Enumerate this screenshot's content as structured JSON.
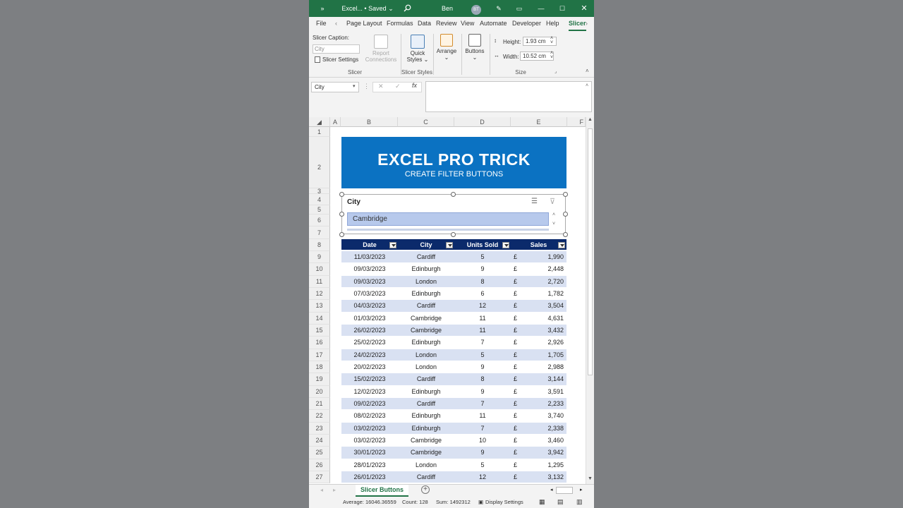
{
  "titlebar": {
    "more_label": "»",
    "file_label": "Excel... • Saved",
    "user_name": "Ben Thompson",
    "user_initials": "BT"
  },
  "ribbon_tabs": [
    "File",
    "Page Layout",
    "Formulas",
    "Data",
    "Review",
    "View",
    "Automate",
    "Developer",
    "Help",
    "Slicer"
  ],
  "ribbon": {
    "slicer_caption_label": "Slicer Caption:",
    "slicer_caption_value": "City",
    "slicer_settings_label": "Slicer Settings",
    "report_connections_label1": "Report",
    "report_connections_label2": "Connections",
    "quick_styles_label1": "Quick",
    "quick_styles_label2": "Styles",
    "arrange_label": "Arrange",
    "buttons_label": "Buttons",
    "height_label": "Height:",
    "height_value": "1.93 cm",
    "width_label": "Width:",
    "width_value": "10.52 cm",
    "group_slicer": "Slicer",
    "group_slicer_styles": "Slicer Styles",
    "group_size": "Size"
  },
  "formula_bar": {
    "name_box": "City",
    "fx_label": "fx",
    "value": ""
  },
  "columns": [
    "A",
    "B",
    "C",
    "D",
    "E",
    "F"
  ],
  "rows": [
    "1",
    "2",
    "3",
    "4",
    "5",
    "6",
    "7",
    "8",
    "9",
    "10",
    "11",
    "12",
    "13",
    "14",
    "15",
    "16",
    "17",
    "18",
    "19",
    "20",
    "21",
    "22",
    "23",
    "24",
    "25",
    "26",
    "27"
  ],
  "banner": {
    "title": "EXCEL PRO TRICK",
    "subtitle": "CREATE FILTER BUTTONS"
  },
  "slicer": {
    "header": "City",
    "selected_item": "Cambridge"
  },
  "table": {
    "headers": [
      "Date",
      "City",
      "Units Sold",
      "Sales"
    ],
    "currency": "£",
    "rows": [
      [
        "11/03/2023",
        "Cardiff",
        "5",
        "1,990"
      ],
      [
        "09/03/2023",
        "Edinburgh",
        "9",
        "2,448"
      ],
      [
        "09/03/2023",
        "London",
        "8",
        "2,720"
      ],
      [
        "07/03/2023",
        "Edinburgh",
        "6",
        "1,782"
      ],
      [
        "04/03/2023",
        "Cardiff",
        "12",
        "3,504"
      ],
      [
        "01/03/2023",
        "Cambridge",
        "11",
        "4,631"
      ],
      [
        "26/02/2023",
        "Cambridge",
        "11",
        "3,432"
      ],
      [
        "25/02/2023",
        "Edinburgh",
        "7",
        "2,926"
      ],
      [
        "24/02/2023",
        "London",
        "5",
        "1,705"
      ],
      [
        "20/02/2023",
        "London",
        "9",
        "2,988"
      ],
      [
        "15/02/2023",
        "Cardiff",
        "8",
        "3,144"
      ],
      [
        "12/02/2023",
        "Edinburgh",
        "9",
        "3,591"
      ],
      [
        "09/02/2023",
        "Cardiff",
        "7",
        "2,233"
      ],
      [
        "08/02/2023",
        "Edinburgh",
        "11",
        "3,740"
      ],
      [
        "03/02/2023",
        "Edinburgh",
        "7",
        "2,338"
      ],
      [
        "03/02/2023",
        "Cambridge",
        "10",
        "3,460"
      ],
      [
        "30/01/2023",
        "Cambridge",
        "9",
        "3,942"
      ],
      [
        "28/01/2023",
        "London",
        "5",
        "1,295"
      ],
      [
        "26/01/2023",
        "Cardiff",
        "12",
        "3,132"
      ]
    ]
  },
  "sheet_tab": "Slicer Buttons",
  "status": {
    "average": "Average: 16046.36559",
    "count": "Count: 128",
    "sum": "Sum: 1492312",
    "display_settings": "Display Settings"
  },
  "colors": {
    "excel_green": "#217346",
    "banner_blue": "#0b72c2",
    "table_header": "#0b2a6b",
    "band": "#d9e1f2"
  }
}
